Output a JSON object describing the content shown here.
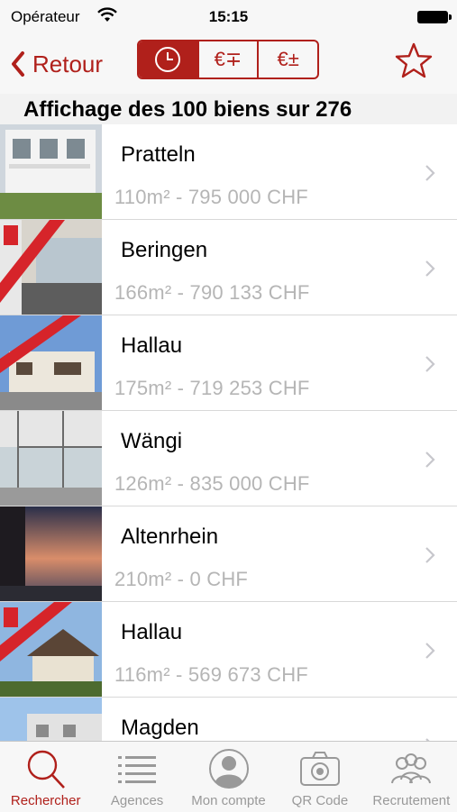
{
  "status_bar": {
    "carrier": "Opérateur",
    "time": "15:15"
  },
  "navbar": {
    "back_label": "Retour",
    "segments": [
      {
        "icon": "clock-icon",
        "active": true
      },
      {
        "label": "€∓",
        "active": false
      },
      {
        "label": "€±",
        "active": false
      }
    ],
    "favorite_icon": "star-icon"
  },
  "list_header": "Affichage des 100 biens sur 276",
  "listings": [
    {
      "city": "Pratteln",
      "details": "110m² - 795 000  CHF"
    },
    {
      "city": "Beringen",
      "details": "166m² - 790 133  CHF"
    },
    {
      "city": "Hallau",
      "details": "175m² - 719 253  CHF"
    },
    {
      "city": "Wängi",
      "details": "126m² - 835 000  CHF"
    },
    {
      "city": "Altenrhein",
      "details": "210m² - 0  CHF"
    },
    {
      "city": "Hallau",
      "details": "116m² - 569 673  CHF"
    },
    {
      "city": "Magden",
      "details": ""
    }
  ],
  "tabbar": [
    {
      "label": "Rechercher",
      "icon": "search-icon",
      "active": true
    },
    {
      "label": "Agences",
      "icon": "list-icon",
      "active": false
    },
    {
      "label": "Mon compte",
      "icon": "account-icon",
      "active": false
    },
    {
      "label": "QR Code",
      "icon": "camera-icon",
      "active": false
    },
    {
      "label": "Recrutement",
      "icon": "people-icon",
      "active": false
    }
  ],
  "colors": {
    "accent": "#b0201b",
    "secondary_text": "#b5b5b5"
  }
}
